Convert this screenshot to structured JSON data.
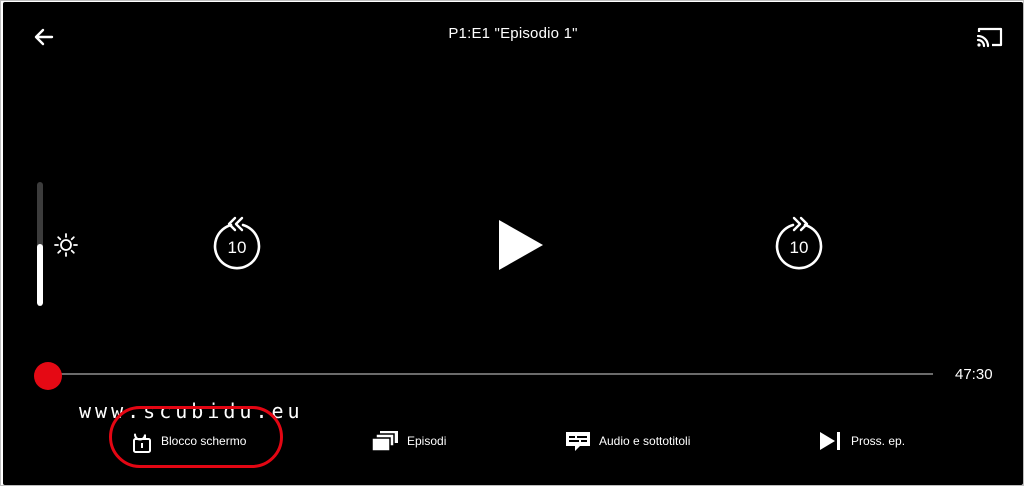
{
  "header": {
    "title": "P1:E1 \"Episodio 1\"",
    "back_icon": "arrow-left-icon",
    "cast_icon": "cast-icon"
  },
  "brightness": {
    "icon": "brightness-icon",
    "level_percent": 50
  },
  "controls": {
    "rewind": {
      "icon": "rewind-10-icon",
      "label": "10"
    },
    "play": {
      "icon": "play-icon"
    },
    "forward": {
      "icon": "forward-10-icon",
      "label": "10"
    }
  },
  "progress": {
    "played_percent": 0,
    "time_remaining": "47:30",
    "accent_color": "#e50914"
  },
  "watermark": "www.scubidu.eu",
  "actions": {
    "lock": {
      "label": "Blocco schermo",
      "icon": "unlock-icon"
    },
    "episodes": {
      "label": "Episodi",
      "icon": "episodes-icon"
    },
    "audio": {
      "label": "Audio e sottotitoli",
      "icon": "subtitles-icon"
    },
    "next": {
      "label": "Pross. ep.",
      "icon": "next-episode-icon"
    }
  },
  "colors": {
    "background": "#000000",
    "foreground": "#ffffff",
    "highlight": "#e30613"
  }
}
